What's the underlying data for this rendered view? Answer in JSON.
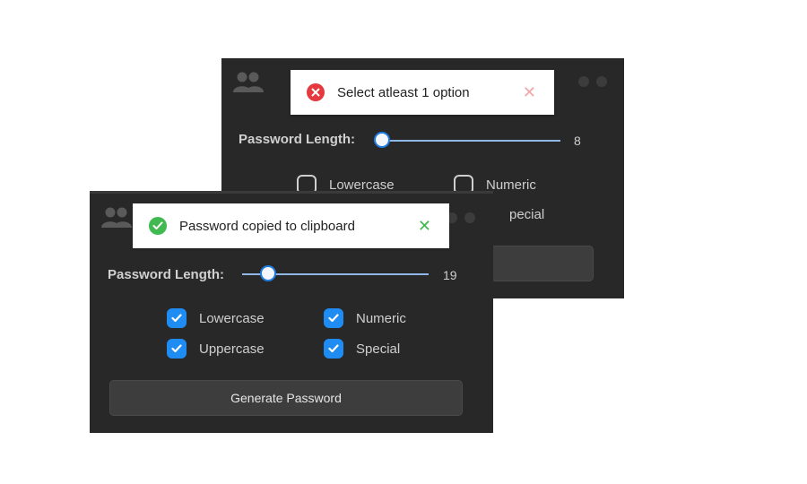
{
  "back_window": {
    "toast": {
      "message": "Select atleast 1 option",
      "icon": "error-circle-icon",
      "status_color": "#e5383f"
    },
    "length_label": "Password Length:",
    "length_value": "8",
    "slider_fraction": 0.0,
    "options": [
      {
        "label": "Lowercase",
        "checked": false
      },
      {
        "label": "Numeric",
        "checked": false
      },
      {
        "label": "Special",
        "checked": false
      }
    ],
    "partial_special_text": "pecial"
  },
  "front_window": {
    "toast": {
      "message": "Password copied to clipboard",
      "icon": "success-check-icon",
      "status_color": "#3fb950"
    },
    "length_label": "Password Length:",
    "length_value": "19",
    "slider_fraction": 0.14,
    "options": [
      {
        "label": "Lowercase",
        "checked": true
      },
      {
        "label": "Numeric",
        "checked": true
      },
      {
        "label": "Uppercase",
        "checked": true
      },
      {
        "label": "Special",
        "checked": true
      }
    ],
    "generate_label": "Generate Password"
  },
  "colors": {
    "accent": "#1e8cf2",
    "window_bg": "#282828"
  }
}
